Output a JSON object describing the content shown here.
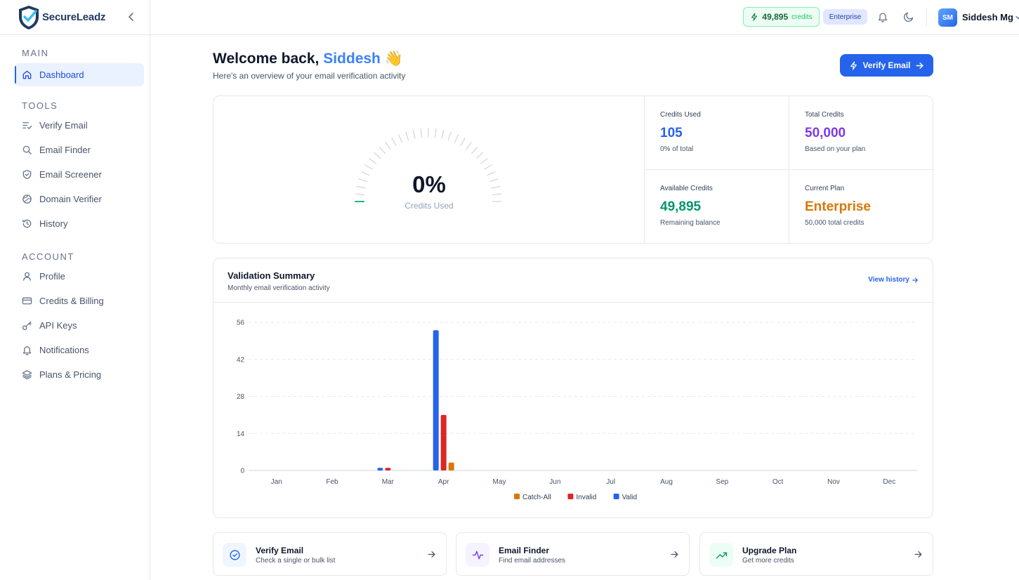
{
  "brand": {
    "name": "SecureLeadz"
  },
  "sidebar": {
    "sections": [
      {
        "title": "MAIN",
        "items": [
          {
            "label": "Dashboard",
            "icon": "home-icon",
            "active": true
          }
        ]
      },
      {
        "title": "TOOLS",
        "items": [
          {
            "label": "Verify Email",
            "icon": "list-check-icon"
          },
          {
            "label": "Email Finder",
            "icon": "search-icon"
          },
          {
            "label": "Email Screener",
            "icon": "shield-check-icon"
          },
          {
            "label": "Domain Verifier",
            "icon": "globe-icon"
          },
          {
            "label": "History",
            "icon": "history-icon"
          }
        ]
      },
      {
        "title": "ACCOUNT",
        "items": [
          {
            "label": "Profile",
            "icon": "user-icon"
          },
          {
            "label": "Credits & Billing",
            "icon": "credit-card-icon"
          },
          {
            "label": "API Keys",
            "icon": "key-icon"
          },
          {
            "label": "Notifications",
            "icon": "bell-icon"
          },
          {
            "label": "Plans & Pricing",
            "icon": "layers-icon"
          }
        ]
      }
    ]
  },
  "topbar": {
    "credits_value": "49,895",
    "credits_label": "credits",
    "plan_badge": "Enterprise",
    "avatar_initials": "SM",
    "user_name": "Siddesh Mg"
  },
  "header": {
    "welcome_prefix": "Welcome back,",
    "welcome_name": "Siddesh",
    "welcome_emoji": "👋",
    "subtitle": "Here's an overview of your email verification activity",
    "verify_button": "Verify Email"
  },
  "gauge": {
    "value": "0%",
    "label": "Credits Used",
    "fraction": 0
  },
  "stats": [
    {
      "title": "Credits Used",
      "value": "105",
      "sub": "0% of total",
      "color": "#2563eb"
    },
    {
      "title": "Total Credits",
      "value": "50,000",
      "sub": "Based on your plan",
      "color": "#7c3aed"
    },
    {
      "title": "Available Credits",
      "value": "49,895",
      "sub": "Remaining balance",
      "color": "#059669"
    },
    {
      "title": "Current Plan",
      "value": "Enterprise",
      "sub": "50,000 total credits",
      "color": "#d97706"
    }
  ],
  "chart_card": {
    "title": "Validation Summary",
    "subtitle": "Monthly email verification activity",
    "view_history": "View history"
  },
  "chart_data": {
    "type": "bar",
    "categories": [
      "Jan",
      "Feb",
      "Mar",
      "Apr",
      "May",
      "Jun",
      "Jul",
      "Aug",
      "Sep",
      "Oct",
      "Nov",
      "Dec"
    ],
    "series": [
      {
        "name": "Valid",
        "color": "#2563eb",
        "values": [
          0,
          0,
          1,
          53,
          0,
          0,
          0,
          0,
          0,
          0,
          0,
          0
        ]
      },
      {
        "name": "Invalid",
        "color": "#dc2626",
        "values": [
          0,
          0,
          1,
          21,
          0,
          0,
          0,
          0,
          0,
          0,
          0,
          0
        ]
      },
      {
        "name": "Catch-All",
        "color": "#d97706",
        "values": [
          0,
          0,
          0,
          3,
          0,
          0,
          0,
          0,
          0,
          0,
          0,
          0
        ]
      }
    ],
    "legend_order": [
      "Catch-All",
      "Invalid",
      "Valid"
    ],
    "yticks": [
      0,
      14,
      28,
      42,
      56
    ],
    "ylim": [
      0,
      56
    ],
    "grid": true,
    "legend": "bottom-center"
  },
  "quick_actions": [
    {
      "title": "Verify Email",
      "sub": "Check a single or bulk list",
      "icon": "check-circle-icon",
      "bg": "#eff6ff",
      "fg": "#2563eb"
    },
    {
      "title": "Email Finder",
      "sub": "Find email addresses",
      "icon": "activity-icon",
      "bg": "#f5f3ff",
      "fg": "#7c3aed"
    },
    {
      "title": "Upgrade Plan",
      "sub": "Get more credits",
      "icon": "trending-up-icon",
      "bg": "#ecfdf5",
      "fg": "#059669"
    }
  ]
}
